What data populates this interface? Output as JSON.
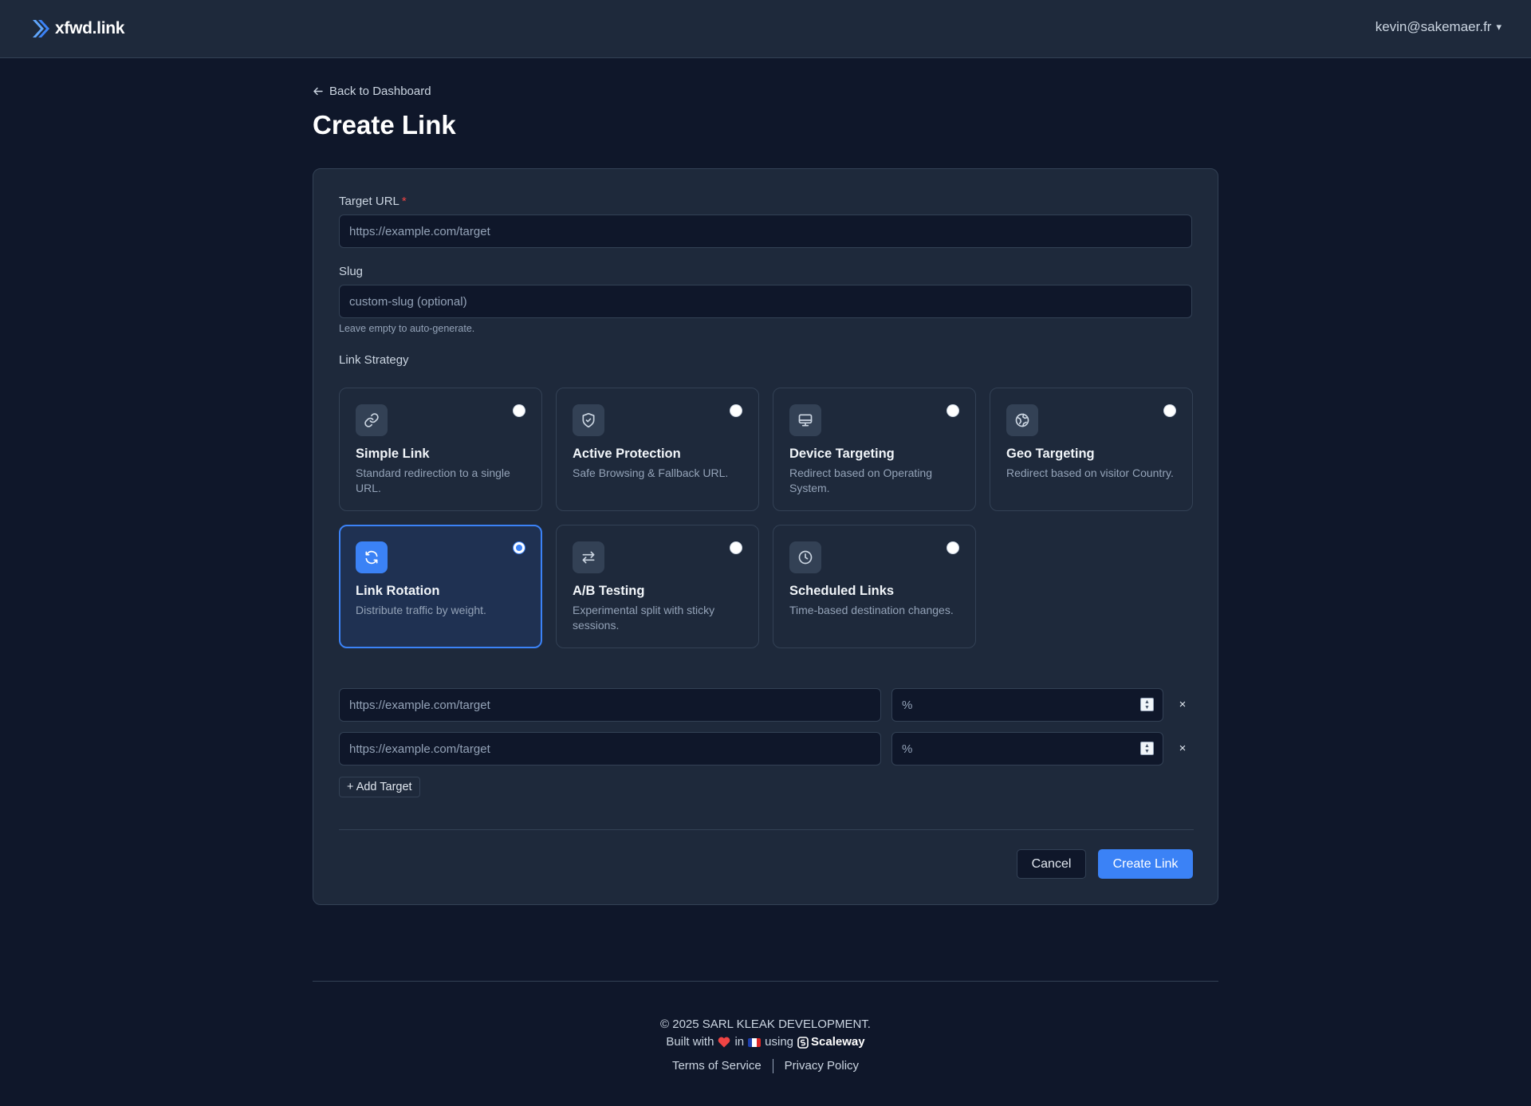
{
  "header": {
    "logo_text": "xfwd.link",
    "user_email": "kevin@sakemaer.fr",
    "user_caret": "▾"
  },
  "page": {
    "back_label": "Back to Dashboard",
    "title": "Create Link"
  },
  "form": {
    "target_url_label": "Target URL",
    "target_url_required": "*",
    "target_url_placeholder": "https://example.com/target",
    "slug_label": "Slug",
    "slug_placeholder": "custom-slug (optional)",
    "slug_hint": "Leave empty to auto-generate.",
    "strategy_label": "Link Strategy",
    "strategies": [
      {
        "title": "Simple Link",
        "desc": "Standard redirection to a single URL.",
        "icon": "link-icon",
        "selected": false
      },
      {
        "title": "Active Protection",
        "desc": "Safe Browsing & Fallback URL.",
        "icon": "shield-icon",
        "selected": false
      },
      {
        "title": "Device Targeting",
        "desc": "Redirect based on Operating System.",
        "icon": "monitor-icon",
        "selected": false
      },
      {
        "title": "Geo Targeting",
        "desc": "Redirect based on visitor Country.",
        "icon": "globe-icon",
        "selected": false
      },
      {
        "title": "Link Rotation",
        "desc": "Distribute traffic by weight.",
        "icon": "rotate-icon",
        "selected": true
      },
      {
        "title": "A/B Testing",
        "desc": "Experimental split with sticky sessions.",
        "icon": "arrows-swap-icon",
        "selected": false
      },
      {
        "title": "Scheduled Links",
        "desc": "Time-based destination changes.",
        "icon": "clock-icon",
        "selected": false
      }
    ],
    "rotation_targets": [
      {
        "url_placeholder": "https://example.com/target",
        "weight_placeholder": "%",
        "remove_label": "×"
      },
      {
        "url_placeholder": "https://example.com/target",
        "weight_placeholder": "%",
        "remove_label": "×"
      }
    ],
    "add_target_label": "+ Add Target",
    "cancel_label": "Cancel",
    "create_label": "Create Link"
  },
  "footer": {
    "copyright": "© 2025 SARL KLEAK DEVELOPMENT.",
    "built_with": "Built with",
    "in": "in",
    "using": "using",
    "provider": "Scaleway",
    "terms": "Terms of Service",
    "privacy": "Privacy Policy"
  },
  "colors": {
    "background": "#0f172a",
    "surface": "#1e293b",
    "border": "#334155",
    "accent": "#3b82f6",
    "required": "#ef4444"
  }
}
